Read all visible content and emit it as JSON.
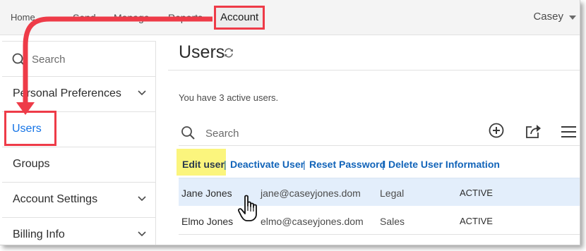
{
  "nav": {
    "home": "Home",
    "send": "Send",
    "manage": "Manage",
    "reports": "Reports",
    "account": "Account",
    "user": "Casey"
  },
  "sidebar": {
    "search_label": "Search",
    "items": [
      {
        "label": "Personal Preferences",
        "expandable": true
      },
      {
        "label": "Users",
        "expandable": false,
        "selected": true
      },
      {
        "label": "Groups",
        "expandable": false
      },
      {
        "label": "Account Settings",
        "expandable": true
      },
      {
        "label": "Billing Info",
        "expandable": true
      }
    ]
  },
  "main": {
    "title": "Users",
    "active_summary": "You have 3 active users.",
    "search_label": "Search",
    "actions": {
      "edit": "Edit user",
      "deactivate": "Deactivate User",
      "reset": "Reset Password",
      "delete": "Delete User Information",
      "separator": "|"
    },
    "users": [
      {
        "name": "Jane Jones",
        "email": "jane@caseyjones.dom",
        "group": "Legal",
        "status": "ACTIVE"
      },
      {
        "name": "Elmo Jones",
        "email": "elmo@caseyjones.dom",
        "group": "Sales",
        "status": "ACTIVE"
      }
    ]
  },
  "colors": {
    "highlight_red": "#ee3b48",
    "link_blue": "#1264b9",
    "selected_blue": "#1473e6",
    "edit_highlight": "#fbf57d",
    "row_selected": "#e3eefb"
  },
  "icons": [
    "refresh-icon",
    "search-icon",
    "add-circle-icon",
    "share-icon",
    "menu-icon",
    "chevron-down-icon",
    "hand-cursor-icon"
  ]
}
